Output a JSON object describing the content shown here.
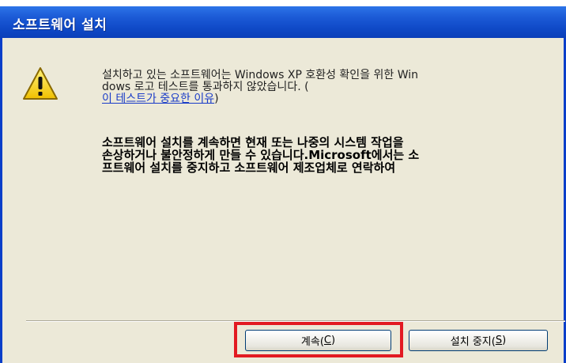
{
  "window": {
    "title": "소프트웨어 설치"
  },
  "message": {
    "line1": "설치하고 있는 소프트웨어는 Windows XP 호환성 확인을 위한 Win",
    "line2": "dows 로고 테스트를 통과하지 않았습니다. (",
    "link": "이 테스트가 중요한 이유",
    "link_suffix": ")"
  },
  "warning": {
    "line1": "소프트웨어 설치를 계속하면 현재 또는 나중의 시스템 작업을",
    "line2": "손상하거나 불안정하게 만들 수 있습니다.Microsoft에서는 소",
    "line3": "프트웨어 설치를 중지하고 소프트웨어 제조업체로 연락하여"
  },
  "buttons": {
    "continue_label": "계속(",
    "continue_hotkey": "C",
    "continue_suffix": ")",
    "stop_label": "설치 중지(",
    "stop_hotkey": "S",
    "stop_suffix": ")"
  },
  "colors": {
    "titlebar": "#0f49c7",
    "dialog_bg": "#ece9d8",
    "link": "#1a3cc8",
    "highlight": "#e21a22"
  },
  "icons": {
    "warning": "warning-icon"
  }
}
